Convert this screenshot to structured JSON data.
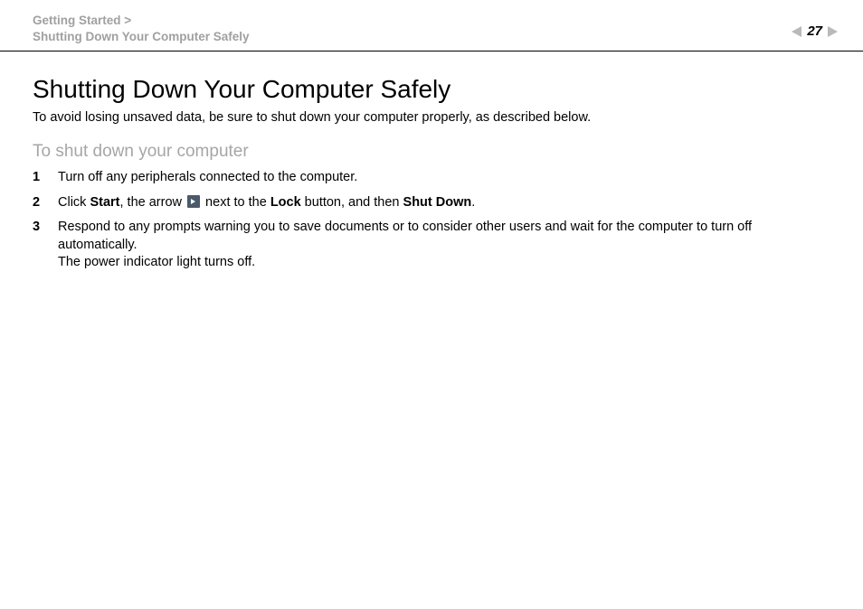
{
  "header": {
    "breadcrumb_top": "Getting Started >",
    "breadcrumb_bottom": "Shutting Down Your Computer Safely",
    "page_number": "27"
  },
  "content": {
    "title": "Shutting Down Your Computer Safely",
    "intro": "To avoid losing unsaved data, be sure to shut down your computer properly, as described below.",
    "subtitle": "To shut down your computer",
    "step1": "Turn off any peripherals connected to the computer.",
    "step2": {
      "p1": "Click ",
      "b1": "Start",
      "p2": ", the arrow ",
      "p3": " next to the ",
      "b2": "Lock",
      "p4": " button, and then ",
      "b3": "Shut Down",
      "p5": "."
    },
    "step3": {
      "line1": "Respond to any prompts warning you to save documents or to consider other users and wait for the computer to turn off automatically.",
      "line2": "The power indicator light turns off."
    }
  }
}
